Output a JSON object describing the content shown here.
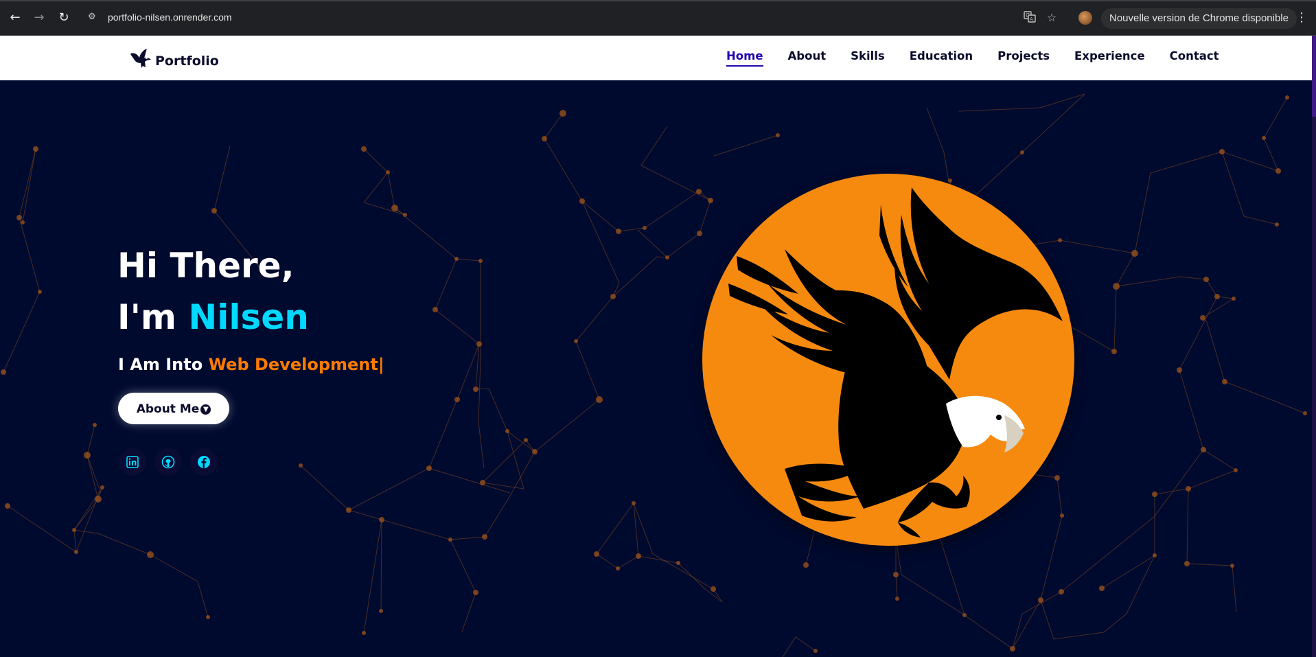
{
  "browser": {
    "url": "portfolio-nilsen.onrender.com",
    "update_notice": "Nouvelle version de Chrome disponible",
    "icons": [
      "back-arrow-icon",
      "forward-arrow-icon",
      "reload-icon",
      "site-info-icon",
      "translate-icon",
      "bookmark-star-icon",
      "profile-avatar",
      "menu-dots-icon"
    ]
  },
  "header": {
    "logo_text": "Portfolio",
    "nav": [
      {
        "label": "Home",
        "active": true
      },
      {
        "label": "About",
        "active": false
      },
      {
        "label": "Skills",
        "active": false
      },
      {
        "label": "Education",
        "active": false
      },
      {
        "label": "Projects",
        "active": false
      },
      {
        "label": "Experience",
        "active": false
      },
      {
        "label": "Contact",
        "active": false
      }
    ]
  },
  "hero": {
    "greeting": "Hi There,",
    "intro_prefix": "I'm ",
    "name": "Nilsen",
    "typed_prefix": "I Am Into ",
    "typed_field": "Web Development|",
    "button_label": "About Me",
    "social_icons": [
      "linkedin-icon",
      "github-icon",
      "facebook-icon"
    ]
  },
  "colors": {
    "background": "#000a2e",
    "accent_cyan": "#00d9ff",
    "accent_orange": "#ff7b00",
    "disk_orange": "#f68a0f",
    "nav_active": "#2506ad"
  }
}
